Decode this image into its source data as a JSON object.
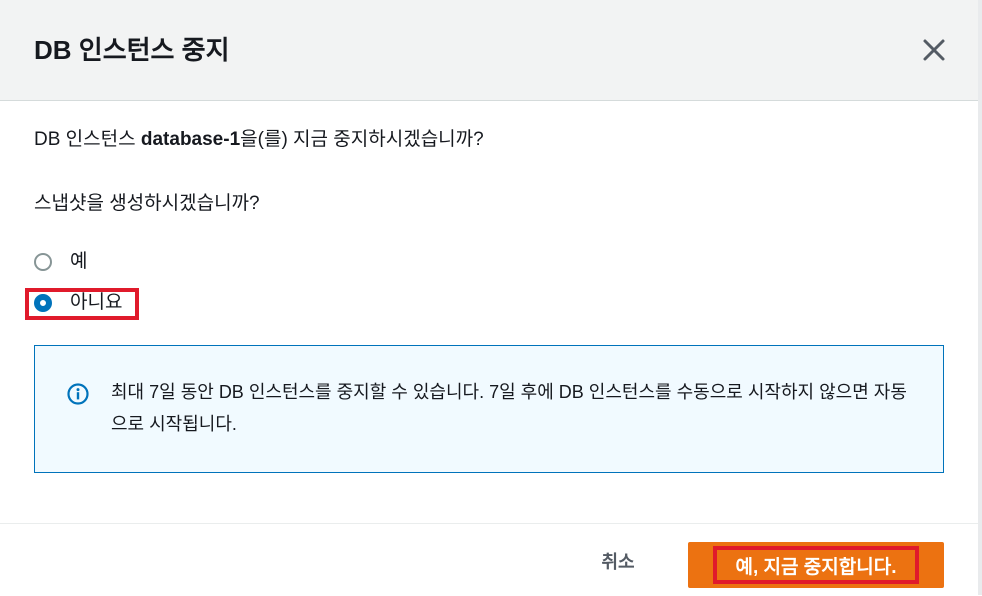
{
  "modal": {
    "title": "DB 인스턴스 중지",
    "close_icon": "close-icon"
  },
  "body": {
    "question_prefix": "DB 인스턴스 ",
    "db_name": "database-1",
    "question_suffix": "을(를) 지금 중지하시겠습니까?",
    "snapshot_question": "스냅샷을 생성하시겠습니까?",
    "options": [
      {
        "label": "예",
        "selected": false
      },
      {
        "label": "아니요",
        "selected": true
      }
    ]
  },
  "alert": {
    "icon": "info-icon",
    "text": "최대 7일 동안 DB 인스턴스를 중지할 수 있습니다. 7일 후에 DB 인스턴스를 수동으로 시작하지 않으면 자동으로 시작됩니다."
  },
  "footer": {
    "cancel_label": "취소",
    "confirm_label": "예, 지금 중지합니다."
  },
  "colors": {
    "primary_button": "#ec7211",
    "radio_selected": "#0073bb",
    "info_border": "#0073bb",
    "annotation": "#e01a2b"
  }
}
